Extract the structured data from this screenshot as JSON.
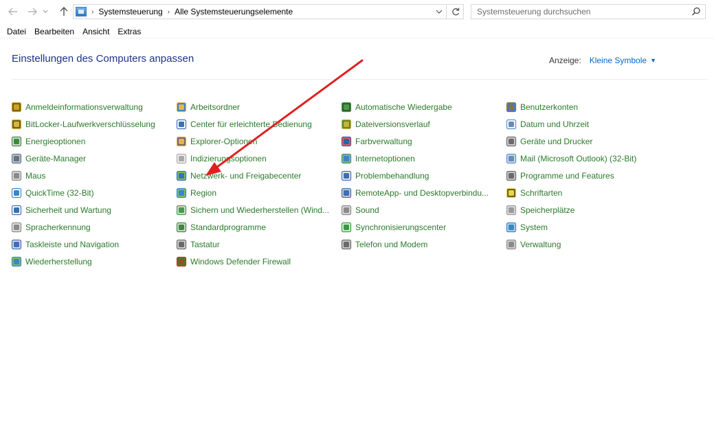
{
  "nav": {
    "back_icon": "back-arrow-icon",
    "forward_icon": "forward-arrow-icon",
    "up_icon": "up-arrow-icon",
    "breadcrumbs": [
      "Systemsteuerung",
      "Alle Systemsteuerungselemente"
    ],
    "search_placeholder": "Systemsteuerung durchsuchen"
  },
  "menu": [
    "Datei",
    "Bearbeiten",
    "Ansicht",
    "Extras"
  ],
  "header": {
    "title": "Einstellungen des Computers anpassen",
    "view_label": "Anzeige:",
    "view_value": "Kleine Symbole"
  },
  "items": [
    [
      "Anmeldeinformationsverwaltung",
      "Arbeitsordner",
      "Automatische Wiedergabe",
      "Benutzerkonten"
    ],
    [
      "BitLocker-Laufwerkverschlüsselung",
      "Center für erleichterte Bedienung",
      "Dateiversionsverlauf",
      "Datum und Uhrzeit"
    ],
    [
      "Energieoptionen",
      "Explorer-Optionen",
      "Farbverwaltung",
      "Geräte und Drucker"
    ],
    [
      "Geräte-Manager",
      "Indizierungsoptionen",
      "Internetoptionen",
      "Mail (Microsoft Outlook) (32-Bit)"
    ],
    [
      "Maus",
      "Netzwerk- und Freigabecenter",
      "Problembehandlung",
      "Programme und Features"
    ],
    [
      "QuickTime (32-Bit)",
      "Region",
      "RemoteApp- und Desktopverbindu...",
      "Schriftarten"
    ],
    [
      "Sicherheit und Wartung",
      "Sichern und Wiederherstellen (Wind...",
      "Sound",
      "Speicherplätze"
    ],
    [
      "Spracherkennung",
      "Standardprogramme",
      "Synchronisierungscenter",
      "System"
    ],
    [
      "Taskleiste und Navigation",
      "Tastatur",
      "Telefon und Modem",
      "Verwaltung"
    ],
    [
      "Wiederherstellung",
      "Windows Defender Firewall",
      "",
      ""
    ]
  ],
  "colors": {
    "link_green": "#2a7a2a",
    "title_blue": "#1e3287",
    "view_blue": "#0066cc",
    "annotation_arrow": "#e02020"
  }
}
